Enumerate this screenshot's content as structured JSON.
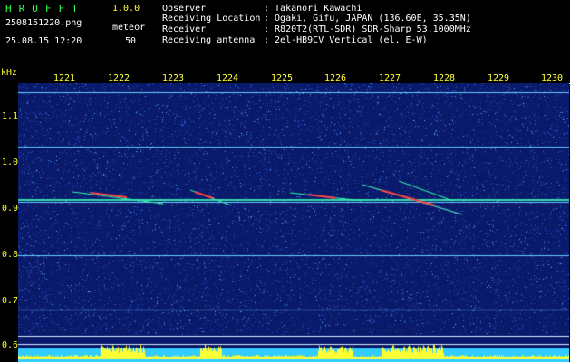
{
  "header": {
    "app_name": "HROFFT",
    "version": "1.0.0",
    "filename": "2508151220.png",
    "datetime": "25.08.15 12:20",
    "meteor_label": "meteor",
    "meteor_count": "50",
    "info": [
      {
        "label": "Observer",
        "value": ": Takanori Kawachi"
      },
      {
        "label": "Receiving Location",
        "value": ": Ogaki, Gifu, JAPAN (136.60E, 35.35N)"
      },
      {
        "label": "Receiver",
        "value": ": R820T2(RTL-SDR) SDR-Sharp 53.1000MHz"
      },
      {
        "label": "Receiving antenna",
        "value": ": 2el-HB9CV Vertical (el. E-W)"
      }
    ]
  },
  "plot": {
    "y_unit": "kHz",
    "x_ticks": [
      "1221",
      "1222",
      "1223",
      "1224",
      "1225",
      "1226",
      "1227",
      "1228",
      "1229",
      "1230"
    ],
    "y_ticks": [
      "1.1",
      "1.0",
      "0.9",
      "0.8",
      "0.7",
      "0.6"
    ],
    "y_values": [
      1.1,
      1.0,
      0.9,
      0.8,
      0.7,
      0.6
    ],
    "colors": {
      "background": "#0a1a6a",
      "noise_line": "#66ccff",
      "signal": "#ff4444",
      "strip": "#ffff33",
      "strip_base": "#33ccff"
    }
  }
}
